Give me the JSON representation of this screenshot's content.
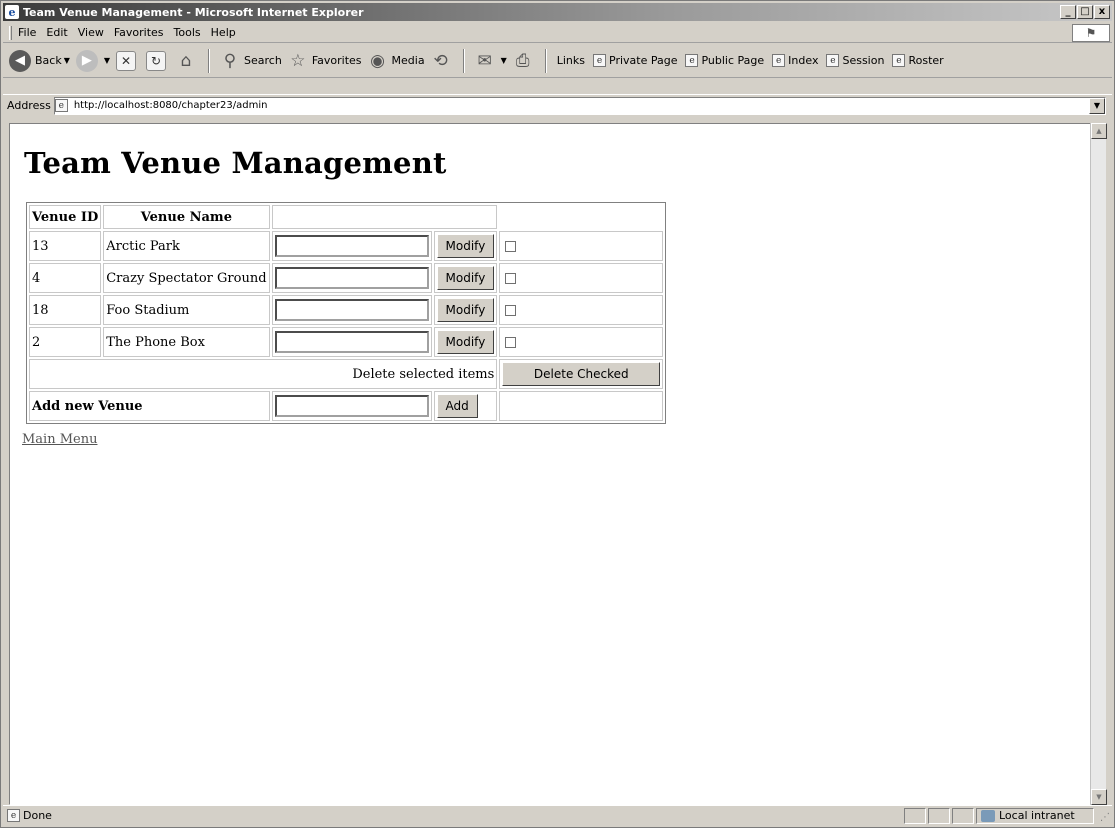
{
  "window": {
    "title": "Team Venue Management - Microsoft Internet Explorer",
    "app_icon_glyph": "e",
    "controls": {
      "minimize": "_",
      "maximize": "□",
      "close": "x"
    }
  },
  "menu": [
    "File",
    "Edit",
    "View",
    "Favorites",
    "Tools",
    "Help"
  ],
  "toolbar": {
    "back": "Back",
    "search": "Search",
    "favorites": "Favorites",
    "media": "Media"
  },
  "links": {
    "label": "Links",
    "items": [
      "Private Page",
      "Public Page",
      "Index",
      "Session",
      "Roster"
    ]
  },
  "address": {
    "label": "Address",
    "url": "http://localhost:8080/chapter23/admin"
  },
  "page": {
    "title": "Team Venue Management",
    "headers": {
      "id": "Venue ID",
      "name": "Venue Name"
    },
    "rows": [
      {
        "id": "13",
        "name": "Arctic Park",
        "input": "",
        "button": "Modify",
        "checked": false
      },
      {
        "id": "4",
        "name": "Crazy Spectator Ground",
        "input": "",
        "button": "Modify",
        "checked": false
      },
      {
        "id": "18",
        "name": "Foo Stadium",
        "input": "",
        "button": "Modify",
        "checked": false
      },
      {
        "id": "2",
        "name": "The Phone Box",
        "input": "",
        "button": "Modify",
        "checked": false
      }
    ],
    "delete_label": "Delete selected items",
    "delete_button": "Delete Checked",
    "add_label": "Add new Venue",
    "add_input": "",
    "add_button": "Add",
    "main_menu_link": "Main Menu"
  },
  "status": {
    "text": "Done",
    "zone": "Local intranet"
  }
}
